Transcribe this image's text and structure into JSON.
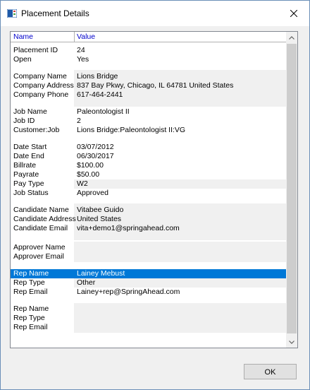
{
  "window": {
    "title": "Placement Details",
    "icon": "app-window-icon",
    "close_icon": "close-icon"
  },
  "list": {
    "columns": {
      "name": "Name",
      "value": "Value"
    },
    "rows": [
      {
        "name": "Placement ID",
        "value": "24"
      },
      {
        "name": "Open",
        "value": "Yes"
      },
      {
        "name": "Company Name",
        "value": "Lions Bridge"
      },
      {
        "name": "Company Address",
        "value": "837 Bay Pkwy, Chicago, IL 64781 United States"
      },
      {
        "name": "Company Phone",
        "value": "617-464-2441"
      },
      {
        "name": "Job Name",
        "value": "Paleontologist II"
      },
      {
        "name": "Job ID",
        "value": "2"
      },
      {
        "name": "Customer:Job",
        "value": "Lions Bridge:Paleontologist II:VG"
      },
      {
        "name": "Date Start",
        "value": "03/07/2012"
      },
      {
        "name": "Date End",
        "value": "06/30/2017"
      },
      {
        "name": "Billrate",
        "value": "$100.00"
      },
      {
        "name": "Payrate",
        "value": "$50.00"
      },
      {
        "name": "Pay Type",
        "value": "W2"
      },
      {
        "name": "Job Status",
        "value": "Approved"
      },
      {
        "name": "Candidate Name",
        "value": "Vitabee Guido"
      },
      {
        "name": "Candidate Address",
        "value": "United States"
      },
      {
        "name": "Candidate Email",
        "value": "vita+demo1@springahead.com"
      },
      {
        "name": "Approver Name",
        "value": ""
      },
      {
        "name": "Approver Email",
        "value": ""
      },
      {
        "name": "Rep Name",
        "value": "Lainey Mebust"
      },
      {
        "name": "Rep Type",
        "value": "Other"
      },
      {
        "name": "Rep Email",
        "value": "Lainey+rep@SpringAhead.com"
      },
      {
        "name": "Rep Name",
        "value": ""
      },
      {
        "name": "Rep Type",
        "value": ""
      },
      {
        "name": "Rep Email",
        "value": ""
      }
    ]
  },
  "buttons": {
    "ok": "OK"
  }
}
